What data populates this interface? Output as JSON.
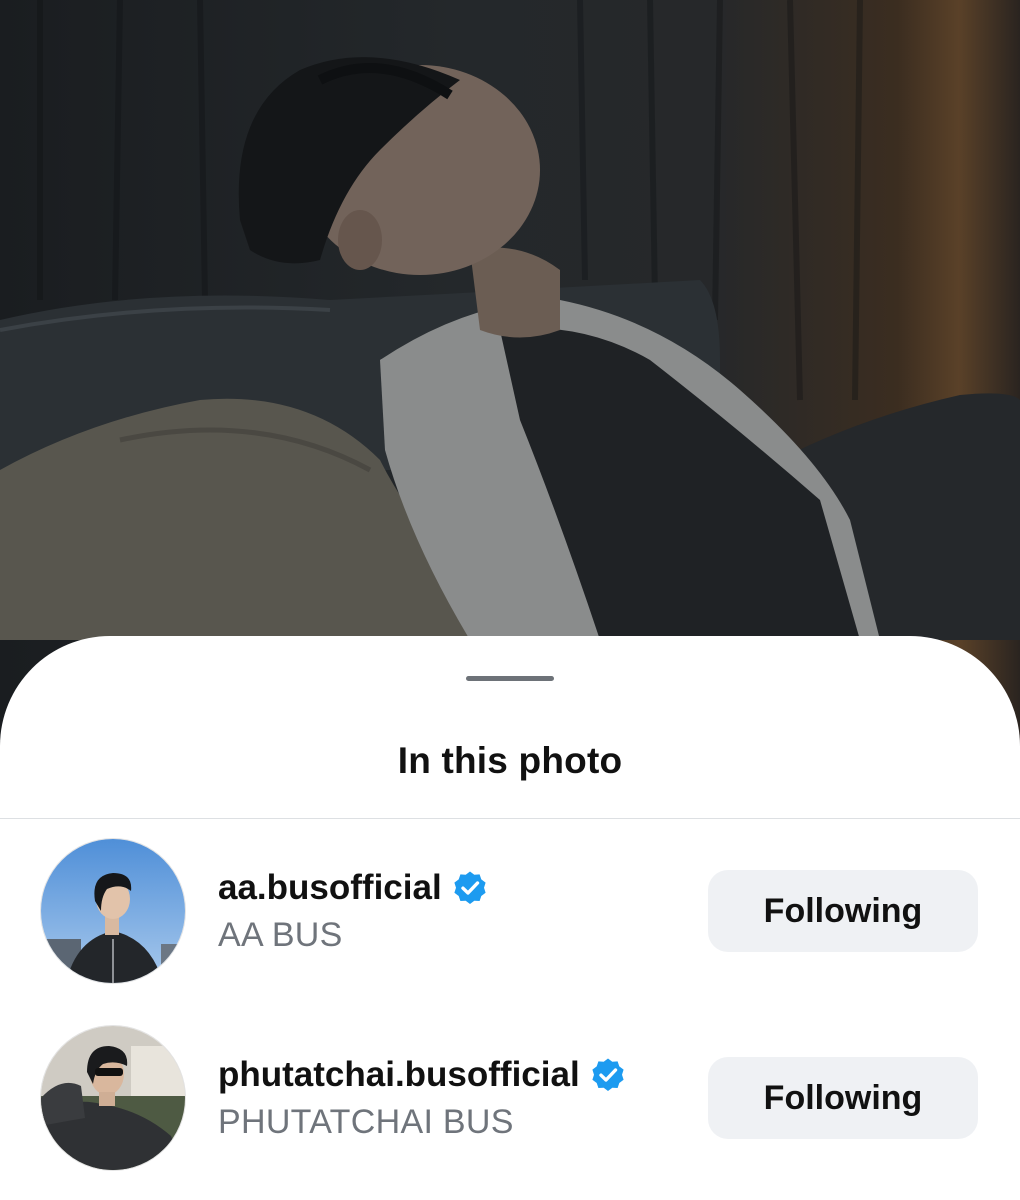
{
  "sheet": {
    "title": "In this photo"
  },
  "tagged_accounts": [
    {
      "username": "aa.busofficial",
      "full_name": "AA BUS",
      "verified": true,
      "button_label": "Following"
    },
    {
      "username": "phutatchai.busofficial",
      "full_name": "PHUTATCHAI BUS",
      "verified": true,
      "button_label": "Following"
    }
  ],
  "colors": {
    "verified_badge": "#1d9bf0",
    "button_bg": "#eff1f4",
    "secondary_text": "#6f747b"
  },
  "icons": {
    "verified": "verified-badge-icon",
    "grabber": "sheet-grabber"
  }
}
